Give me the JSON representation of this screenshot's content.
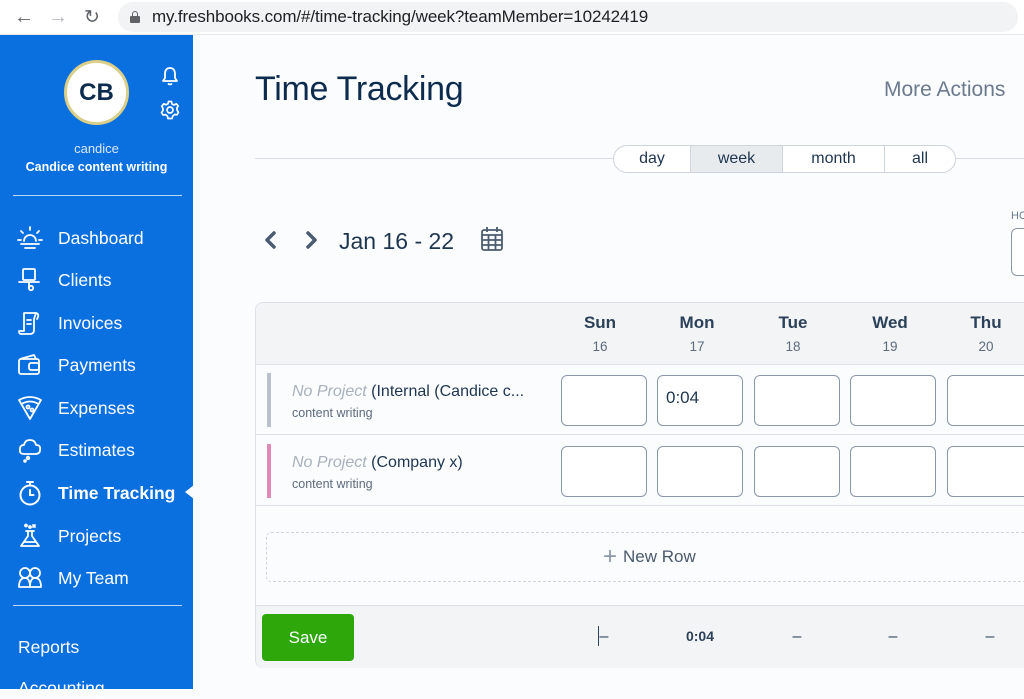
{
  "browser": {
    "url": "my.freshbooks.com/#/time-tracking/week?teamMember=10242419",
    "back_icon": "arrow-left-icon",
    "forward_icon": "arrow-right-icon",
    "reload_icon": "reload-icon"
  },
  "sidebar": {
    "avatar_initials": "CB",
    "user_name": "candice",
    "business_name": "Candice content writing",
    "nav_items": [
      {
        "label": "Dashboard",
        "icon": "sun-icon"
      },
      {
        "label": "Clients",
        "icon": "clients-icon"
      },
      {
        "label": "Invoices",
        "icon": "invoice-icon"
      },
      {
        "label": "Payments",
        "icon": "wallet-icon"
      },
      {
        "label": "Expenses",
        "icon": "pizza-icon"
      },
      {
        "label": "Estimates",
        "icon": "cloud-icon"
      },
      {
        "label": "Time Tracking",
        "icon": "stopwatch-icon",
        "active": true
      },
      {
        "label": "Projects",
        "icon": "flask-icon"
      },
      {
        "label": "My Team",
        "icon": "team-icon"
      }
    ],
    "secondary_items": [
      {
        "label": "Reports"
      },
      {
        "label": "Accounting"
      }
    ]
  },
  "header": {
    "title": "Time Tracking",
    "more_actions": "More Actions"
  },
  "view_toggle": {
    "options": [
      "day",
      "week",
      "month",
      "all"
    ],
    "selected": "week"
  },
  "week_nav": {
    "date_range": "Jan 16 - 22",
    "hours_label": "HO"
  },
  "table": {
    "days": [
      {
        "name": "Sun",
        "date": "16"
      },
      {
        "name": "Mon",
        "date": "17"
      },
      {
        "name": "Tue",
        "date": "18"
      },
      {
        "name": "Wed",
        "date": "19"
      },
      {
        "name": "Thu",
        "date": "20"
      }
    ],
    "rows": [
      {
        "project": "No Project",
        "client": "(Internal (Candice c...",
        "service": "content writing",
        "color": "#b9c2cc",
        "values": [
          "",
          "0:04",
          "",
          "",
          ""
        ]
      },
      {
        "project": "No Project",
        "client": "(Company x)",
        "service": "content writing",
        "color": "#e28ab7",
        "values": [
          "",
          "",
          "",
          "",
          ""
        ]
      }
    ],
    "new_row_label": "New Row",
    "save_label": "Save",
    "totals": [
      "–",
      "0:04",
      "–",
      "–",
      "–"
    ]
  }
}
